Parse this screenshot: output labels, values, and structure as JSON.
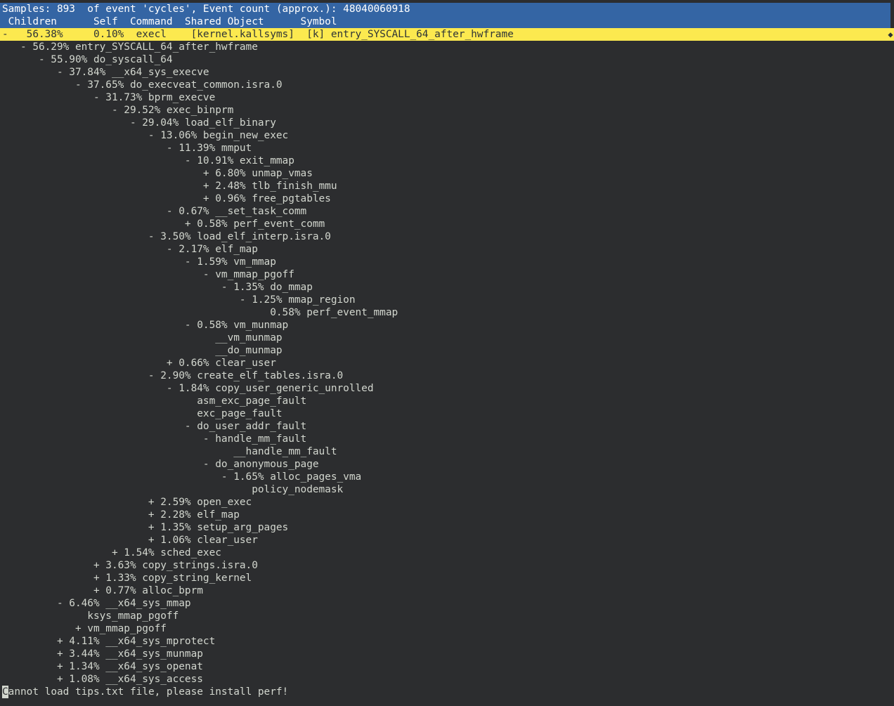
{
  "header": {
    "title": "Samples: 893  of event 'cycles', Event count (approx.): 48040060918",
    "columns": " Children      Self  Command  Shared Object      Symbol"
  },
  "selected": {
    "text": "-   56.38%     0.10%  execl    [kernel.kallsyms]  [k] entry_SYSCALL_64_after_hwframe"
  },
  "tree": [
    "   - 56.29% entry_SYSCALL_64_after_hwframe",
    "      - 55.90% do_syscall_64",
    "         - 37.84% __x64_sys_execve",
    "            - 37.65% do_execveat_common.isra.0",
    "               - 31.73% bprm_execve",
    "                  - 29.52% exec_binprm",
    "                     - 29.04% load_elf_binary",
    "                        - 13.06% begin_new_exec",
    "                           - 11.39% mmput",
    "                              - 10.91% exit_mmap",
    "                                 + 6.80% unmap_vmas",
    "                                 + 2.48% tlb_finish_mmu",
    "                                 + 0.96% free_pgtables",
    "                           - 0.67% __set_task_comm",
    "                              + 0.58% perf_event_comm",
    "                        - 3.50% load_elf_interp.isra.0",
    "                           - 2.17% elf_map",
    "                              - 1.59% vm_mmap",
    "                                 - vm_mmap_pgoff",
    "                                    - 1.35% do_mmap",
    "                                       - 1.25% mmap_region",
    "                                            0.58% perf_event_mmap",
    "                              - 0.58% vm_munmap",
    "                                   __vm_munmap",
    "                                   __do_munmap",
    "                           + 0.66% clear_user",
    "                        - 2.90% create_elf_tables.isra.0",
    "                           - 1.84% copy_user_generic_unrolled",
    "                                asm_exc_page_fault",
    "                                exc_page_fault",
    "                              - do_user_addr_fault",
    "                                 - handle_mm_fault",
    "                                      __handle_mm_fault",
    "                                 - do_anonymous_page",
    "                                    - 1.65% alloc_pages_vma",
    "                                         policy_nodemask",
    "                        + 2.59% open_exec",
    "                        + 2.28% elf_map",
    "                        + 1.35% setup_arg_pages",
    "                        + 1.06% clear_user",
    "                  + 1.54% sched_exec",
    "               + 3.63% copy_strings.isra.0",
    "               + 1.33% copy_string_kernel",
    "               + 0.77% alloc_bprm",
    "         - 6.46% __x64_sys_mmap",
    "              ksys_mmap_pgoff",
    "            + vm_mmap_pgoff",
    "         + 4.11% __x64_sys_mprotect",
    "         + 3.44% __x64_sys_munmap",
    "         + 1.34% __x64_sys_openat",
    "         + 1.08% __x64_sys_access"
  ],
  "status": {
    "cursor_char": "C",
    "rest": "annot load tips.txt file, please install perf!"
  },
  "colors": {
    "background": "#2c2d2f",
    "header_bg": "#3465a4",
    "selected_bg": "#fce94f",
    "text": "#d3d7cf"
  },
  "icons": {
    "scroll_marker": "diamond-icon"
  }
}
